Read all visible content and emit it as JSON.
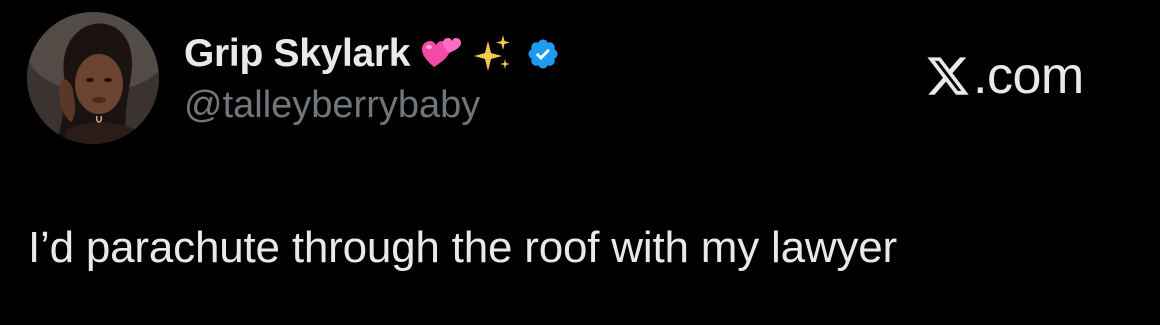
{
  "author": {
    "display_name": "Grip Skylark",
    "handle": "@talleyberrybaby",
    "name_emojis": [
      "two-hearts-icon",
      "sparkles-icon"
    ],
    "verified": true,
    "verified_color": "#1d9bf0"
  },
  "site": {
    "domain": "X.com",
    "domain_suffix": ".com"
  },
  "tweet": {
    "text": "I’d parachute through the roof with my lawyer"
  },
  "colors": {
    "background": "#000000",
    "primary_text": "#e7e9ea",
    "secondary_text": "#71767b",
    "accent": "#1d9bf0"
  }
}
